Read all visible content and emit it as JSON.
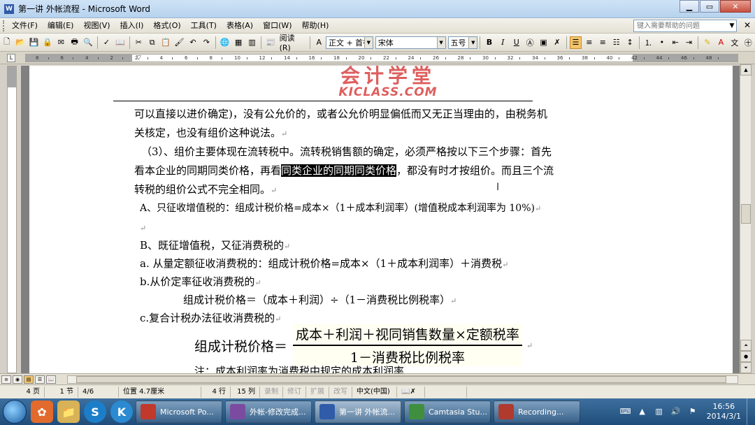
{
  "window": {
    "title": "第一讲 外帐流程 - Microsoft Word",
    "app_icon": "W"
  },
  "menu": {
    "items": [
      "文件(F)",
      "编辑(E)",
      "视图(V)",
      "插入(I)",
      "格式(O)",
      "工具(T)",
      "表格(A)",
      "窗口(W)",
      "帮助(H)"
    ],
    "help_placeholder": "键入需要帮助的问题"
  },
  "toolbar": {
    "read_label": "阅读(R)",
    "style_value": "正文 + 首行",
    "font_value": "宋体",
    "size_value": "五号",
    "bold": "B",
    "italic": "I",
    "underline": "U"
  },
  "ruler": {
    "ticks": [
      "8",
      "6",
      "4",
      "2",
      "2",
      "4",
      "6",
      "8",
      "10",
      "12",
      "14",
      "16",
      "18",
      "20",
      "22",
      "24",
      "26",
      "28",
      "30",
      "32",
      "34",
      "36",
      "38",
      "40",
      "42",
      "44",
      "46",
      "48"
    ]
  },
  "document": {
    "logo_cn": "会计学堂",
    "logo_en": "KICLASS.COM",
    "lines": [
      "可以直接以进价确定)，没有公允价的，或者公允价明显偏低而又无正当理由的，由税务机",
      "关核定，也没有组价这种说法。",
      "（3）、组价主要体现在流转税中。流转税销售额的确定，必须严格按以下三个步骤：首先",
      "看本企业的同期同类价格，再看",
      "同类企业的同期同类价格",
      "，都没有时才按组价。而且三个流",
      "转税的组价公式不完全相同。",
      "A、只征收增值税的：组成计税价格=成本×（1＋成本利润率）(增值税成本利润率为 10%)",
      "B、既征增值税，又征消费税的",
      "a. 从量定额征收消费税的：组成计税价格=成本×（1＋成本利润率）＋消费税",
      "b.从价定率征收消费税的",
      "组成计税价格＝（成本＋利润）÷（1－消费税比例税率）",
      "c.复合计税办法征收消费税的",
      "注：成本利润率为消费税中规定的成本利润率"
    ],
    "formula": {
      "lhs": "组成计税价格＝",
      "numerator": "成本＋利润＋视同销售数量×定额税率",
      "denominator": "1－消费税比例税率"
    }
  },
  "status": {
    "page": "4 页",
    "section": "1 节",
    "page_of": "4/6",
    "position": "位置 4.7厘米",
    "line": "4 行",
    "column": "15 列",
    "rec": "录制",
    "trk": "修订",
    "ext": "扩展",
    "ovr": "改写",
    "language": "中文(中国)"
  },
  "taskbar": {
    "tasks": [
      {
        "label": "Microsoft Po...",
        "color": "#c0392b"
      },
      {
        "label": "外帐-修改完成...",
        "color": "#7b4ba0"
      },
      {
        "label": "第一讲 外帐流...",
        "color": "#2f5ba8"
      },
      {
        "label": "Camtasia Stu...",
        "color": "#3f8f3f"
      },
      {
        "label": "Recording...",
        "color": "#b03a2e"
      }
    ],
    "time": "16:56",
    "date": "2014/3/1"
  }
}
